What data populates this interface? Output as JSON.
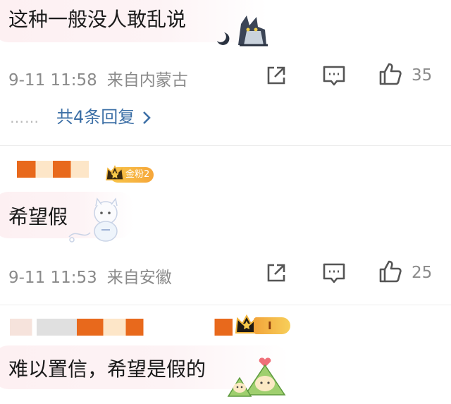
{
  "comments": [
    {
      "text": "这种一般没人敢乱说",
      "time": "9-11 11:58",
      "location": "来自内蒙古",
      "likes": "35"
    },
    {
      "badge": "金粉2",
      "text": "希望假",
      "time": "9-11 11:53",
      "location": "来自安徽",
      "likes": "25"
    },
    {
      "badge": "I",
      "text": "难以置信，希望是假的"
    }
  ],
  "replies": {
    "dots": "……",
    "label": "共4条回复"
  },
  "icons": {
    "share": "share-icon",
    "comment": "comment-icon",
    "like": "thumbs-up-icon",
    "chevron": "chevron-right-icon"
  },
  "colors": {
    "link": "#3c6fa6",
    "meta": "#8a8a8a",
    "badge": "#f6a63a"
  }
}
